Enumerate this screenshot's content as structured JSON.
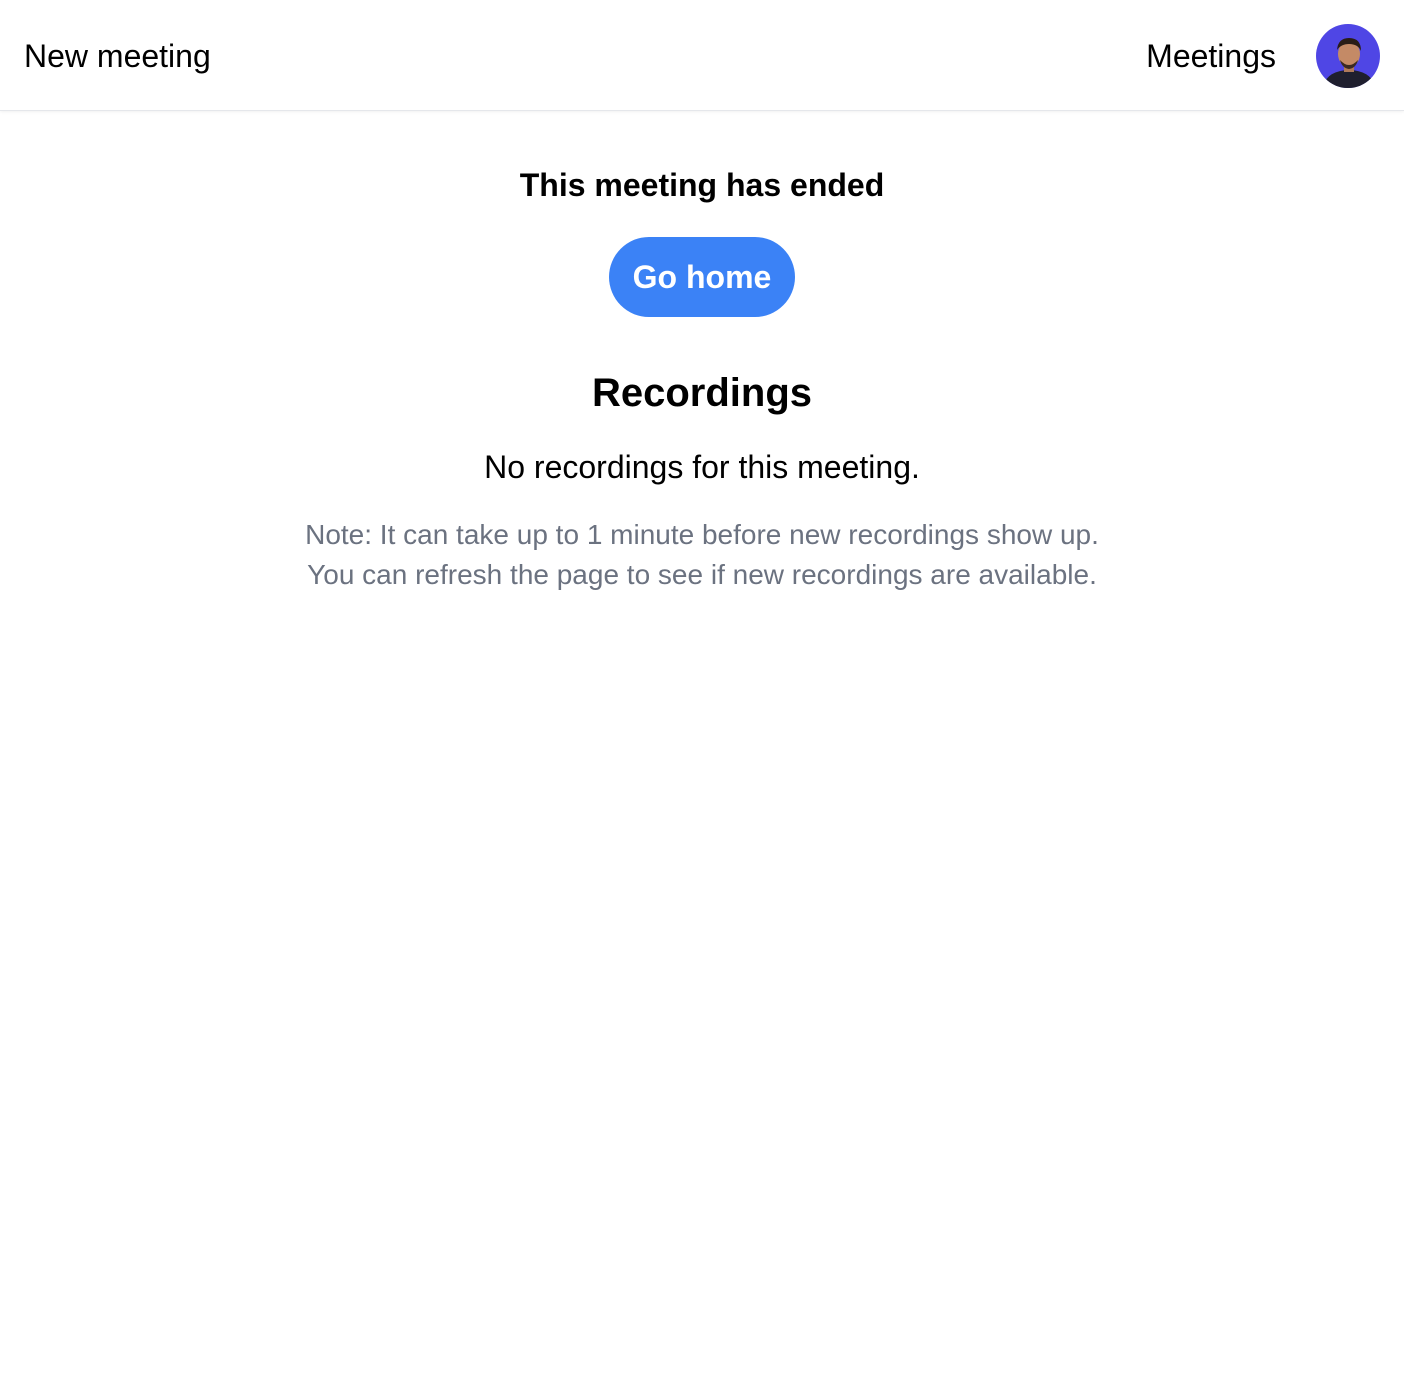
{
  "header": {
    "new_meeting_label": "New meeting",
    "meetings_label": "Meetings",
    "avatar_icon": "user-avatar-icon"
  },
  "main": {
    "ended_title": "This meeting has ended",
    "go_home_label": "Go home",
    "recordings_heading": "Recordings",
    "no_recordings_text": "No recordings for this meeting.",
    "note_line1": "Note: It can take up to 1 minute before new recordings show up.",
    "note_line2": "You can refresh the page to see if new recordings are available."
  },
  "colors": {
    "accent": "#3b82f6",
    "muted_text": "#6b7280",
    "avatar_bg": "#4f46e5"
  }
}
